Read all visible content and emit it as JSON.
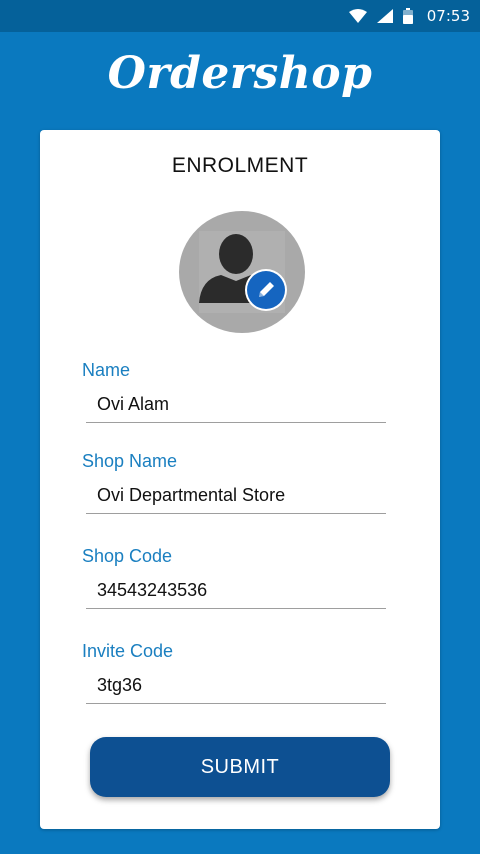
{
  "status_bar": {
    "time": "07:53",
    "icons": [
      "wifi-icon",
      "signal-icon",
      "battery-icon"
    ]
  },
  "app": {
    "title": "Ordershop"
  },
  "form": {
    "title": "ENROLMENT",
    "avatar_icon": "person-icon",
    "edit_icon": "pencil-icon",
    "fields": [
      {
        "label": "Name",
        "value": "Ovi Alam"
      },
      {
        "label": "Shop Name",
        "value": "Ovi Departmental Store"
      },
      {
        "label": "Shop Code",
        "value": "34543243536"
      },
      {
        "label": "Invite Code",
        "value": "3tg36"
      }
    ],
    "submit_label": "SUBMIT"
  },
  "colors": {
    "background": "#0a79bf",
    "status_bar": "#05619a",
    "label": "#1a7fc0",
    "button": "#0d5092",
    "edit_badge": "#1565c0"
  }
}
